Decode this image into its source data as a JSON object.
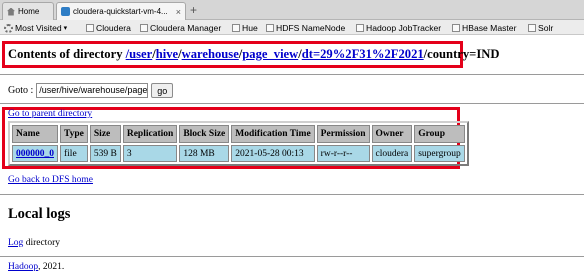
{
  "browser": {
    "tabs": [
      {
        "label": "Home",
        "icon": "home-icon"
      },
      {
        "label": "cloudera-quickstart-vm-4...",
        "icon": "cloudera-favicon",
        "active": true
      }
    ],
    "new_tab": "+",
    "close": "×",
    "bookmarks": [
      {
        "label": "Most Visited",
        "icon": "gear-icon",
        "dropdown": true
      },
      {
        "label": "Cloudera"
      },
      {
        "label": "Cloudera Manager"
      },
      {
        "label": "Hue"
      },
      {
        "label": "HDFS NameNode"
      },
      {
        "label": "Hadoop JobTracker"
      },
      {
        "label": "HBase Master"
      },
      {
        "label": "Solr"
      }
    ]
  },
  "page": {
    "heading_prefix": "Contents of directory",
    "path_parts": [
      "/",
      "user",
      "/",
      "hive",
      "/",
      "warehouse",
      "/",
      "page_view",
      "/",
      "dt=29%2F31%2F2021"
    ],
    "path_suffix": "/country=IND",
    "goto_label": "Goto :",
    "goto_value": "/user/hive/warehouse/page_view",
    "goto_button": "go",
    "parent_link": "Go to parent directory",
    "table": {
      "headers": [
        "Name",
        "Type",
        "Size",
        "Replication",
        "Block Size",
        "Modification Time",
        "Permission",
        "Owner",
        "Group"
      ],
      "rows": [
        [
          "000000_0",
          "file",
          "539 B",
          "3",
          "128 MB",
          "2021-05-28 00:13",
          "rw-r--r--",
          "cloudera",
          "supergroup"
        ]
      ]
    },
    "back_link": "Go back to DFS home",
    "section_title": "Local logs",
    "log_link": "Log",
    "log_suffix": " directory",
    "footer_link": "Hadoop",
    "footer_suffix": ", 2021."
  },
  "colors": {
    "highlight_box": "#e4001a",
    "link": "#0000cc",
    "header_cell": "#bdbdbd",
    "data_cell": "#a9d8e7"
  }
}
